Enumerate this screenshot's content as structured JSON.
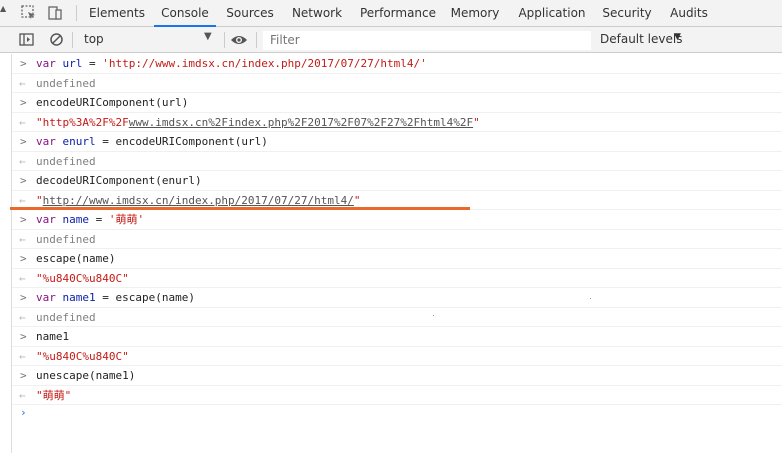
{
  "tabs": [
    "Elements",
    "Console",
    "Sources",
    "Network",
    "Performance",
    "Memory",
    "Application",
    "Security",
    "Audits"
  ],
  "active_tab": "Console",
  "toolbar": {
    "context": "top",
    "filter_placeholder": "Filter",
    "levels": "Default levels"
  },
  "console": [
    {
      "type": "input",
      "parts": [
        [
          "kw",
          "var "
        ],
        [
          "id",
          "url"
        ],
        [
          "plain",
          " = "
        ],
        [
          "str",
          "'http://www.imdsx.cn/index.php/2017/07/27/html4/'"
        ]
      ]
    },
    {
      "type": "output",
      "parts": [
        [
          "undef",
          "undefined"
        ]
      ]
    },
    {
      "type": "input",
      "parts": [
        [
          "plain",
          "encodeURIComponent(url)"
        ]
      ]
    },
    {
      "type": "output",
      "parts": [
        [
          "str",
          "\"http%3A%2F%2F"
        ],
        [
          "link",
          "www.imdsx.cn%2Findex.php%2F2017%2F07%2F27%2Fhtml4%2F"
        ],
        [
          "str",
          "\""
        ]
      ]
    },
    {
      "type": "input",
      "parts": [
        [
          "kw",
          "var "
        ],
        [
          "id",
          "enurl"
        ],
        [
          "plain",
          " = encodeURIComponent(url)"
        ]
      ]
    },
    {
      "type": "output",
      "parts": [
        [
          "undef",
          "undefined"
        ]
      ]
    },
    {
      "type": "input",
      "parts": [
        [
          "plain",
          "decodeURIComponent(enurl)"
        ]
      ]
    },
    {
      "type": "output",
      "parts": [
        [
          "str",
          "\""
        ],
        [
          "link",
          "http://www.imdsx.cn/index.php/2017/07/27/html4/"
        ],
        [
          "str",
          "\""
        ]
      ]
    },
    {
      "type": "input",
      "parts": [
        [
          "kw",
          "var "
        ],
        [
          "id",
          "name"
        ],
        [
          "plain",
          " = "
        ],
        [
          "str",
          "'萌萌'"
        ]
      ]
    },
    {
      "type": "output",
      "parts": [
        [
          "undef",
          "undefined"
        ]
      ]
    },
    {
      "type": "input",
      "parts": [
        [
          "plain",
          "escape(name)"
        ]
      ]
    },
    {
      "type": "output",
      "parts": [
        [
          "str",
          "\"%u840C%u840C\""
        ]
      ]
    },
    {
      "type": "input",
      "parts": [
        [
          "kw",
          "var "
        ],
        [
          "id",
          "name1"
        ],
        [
          "plain",
          " = escape(name)"
        ]
      ]
    },
    {
      "type": "output",
      "parts": [
        [
          "undef",
          "undefined"
        ]
      ]
    },
    {
      "type": "input",
      "parts": [
        [
          "plain",
          "name1"
        ]
      ]
    },
    {
      "type": "output",
      "parts": [
        [
          "str",
          "\"%u840C%u840C\""
        ]
      ]
    },
    {
      "type": "input",
      "parts": [
        [
          "plain",
          "unescape(name1)"
        ]
      ]
    },
    {
      "type": "output",
      "parts": [
        [
          "str",
          "\"萌萌\""
        ]
      ]
    }
  ],
  "icons": {
    "inspect": "inspect-icon",
    "device": "device-toolbar-icon",
    "sidebar": "sidebar-toggle-icon",
    "clear": "clear-console-icon",
    "eye": "live-expression-icon"
  },
  "colors": {
    "accent": "#1a73e8",
    "highlight_line": "#e8692b"
  }
}
